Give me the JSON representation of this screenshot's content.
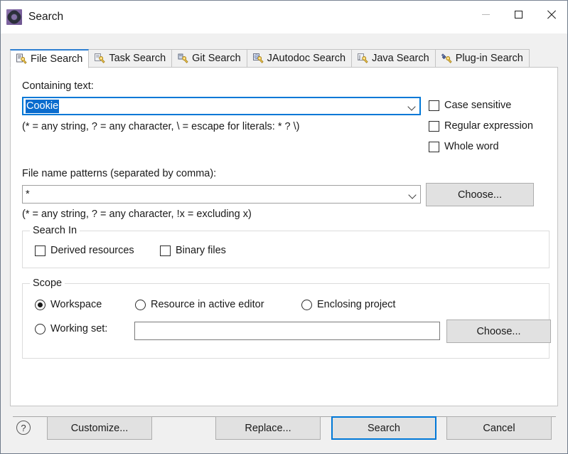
{
  "window": {
    "title": "Search",
    "app_icon": "gear-icon",
    "controls": {
      "minimize": "—",
      "maximize": "□",
      "close": "✕"
    }
  },
  "tabs": [
    {
      "label": "File Search",
      "icon": "file-search-icon",
      "active": true
    },
    {
      "label": "Task Search",
      "icon": "task-search-icon",
      "active": false
    },
    {
      "label": "Git Search",
      "icon": "git-search-icon",
      "active": false
    },
    {
      "label": "JAutodoc Search",
      "icon": "jautodoc-search-icon",
      "active": false
    },
    {
      "label": "Java Search",
      "icon": "java-search-icon",
      "active": false
    },
    {
      "label": "Plug-in Search",
      "icon": "plugin-search-icon",
      "active": false
    }
  ],
  "file_search": {
    "containing_text": {
      "label": "Containing text:",
      "value": "Cookie",
      "selected": true,
      "focused": true,
      "hint": "(* = any string, ? = any character, \\ = escape for literals: * ? \\)"
    },
    "options": [
      {
        "label": "Case sensitive",
        "checked": false
      },
      {
        "label": "Regular expression",
        "checked": false
      },
      {
        "label": "Whole word",
        "checked": false
      }
    ],
    "file_name_patterns": {
      "label": "File name patterns (separated by comma):",
      "value": "*",
      "hint": "(* = any string, ? = any character, !x = excluding x)",
      "choose_label": "Choose..."
    },
    "search_in": {
      "title": "Search In",
      "items": [
        {
          "label": "Derived resources",
          "checked": false
        },
        {
          "label": "Binary files",
          "checked": false
        }
      ]
    },
    "scope": {
      "title": "Scope",
      "radios": [
        {
          "label": "Workspace",
          "selected": true
        },
        {
          "label": "Resource in active editor",
          "selected": false
        },
        {
          "label": "Enclosing project",
          "selected": false
        },
        {
          "label": "Working set:",
          "selected": false
        }
      ],
      "working_set_value": "",
      "working_set_placeholder": "",
      "choose_label": "Choose..."
    }
  },
  "footer": {
    "help_icon": "?",
    "customize_label": "Customize...",
    "replace_label": "Replace...",
    "search_label": "Search",
    "cancel_label": "Cancel"
  },
  "colors": {
    "accent": "#0078d7",
    "selection": "#0a6cce",
    "tab_active_top": "#2f7fd1",
    "dialog_bg": "#f0f0f0",
    "panel_bg": "#ffffff"
  }
}
